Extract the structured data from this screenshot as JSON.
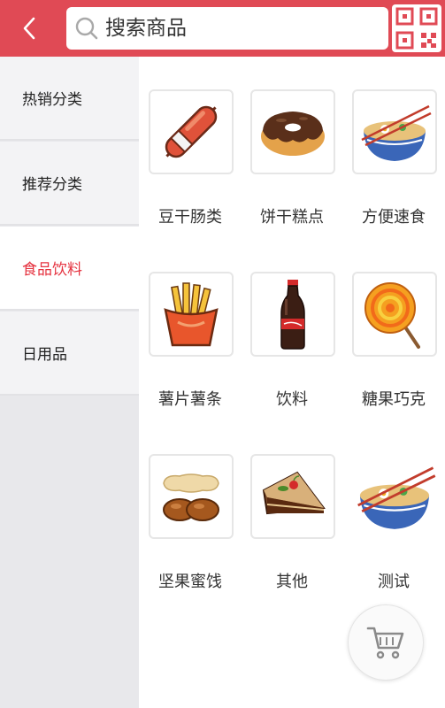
{
  "header": {
    "back_icon": "chevron-left-icon",
    "search_placeholder": "搜索商品",
    "search_icon": "search-icon",
    "qr_icon": "qr-code-icon"
  },
  "sidebar": {
    "items": [
      {
        "label": "热销分类",
        "active": false
      },
      {
        "label": "推荐分类",
        "active": false
      },
      {
        "label": "食品饮料",
        "active": true
      },
      {
        "label": "日用品",
        "active": false
      }
    ]
  },
  "categories": [
    {
      "label": "豆干肠类",
      "icon": "sausage-icon"
    },
    {
      "label": "饼干糕点",
      "icon": "donut-icon"
    },
    {
      "label": "方便速食",
      "icon": "noodle-bowl-icon"
    },
    {
      "label": "薯片薯条",
      "icon": "fries-icon"
    },
    {
      "label": "饮料",
      "icon": "cola-bottle-icon"
    },
    {
      "label": "糖果巧克",
      "icon": "lollipop-icon"
    },
    {
      "label": "坚果蜜饯",
      "icon": "peanut-icon"
    },
    {
      "label": "其他",
      "icon": "cake-icon"
    },
    {
      "label": "测试",
      "icon": "noodle-bowl-icon"
    }
  ],
  "cart": {
    "icon": "shopping-cart-icon"
  },
  "colors": {
    "accent": "#e04a55",
    "active_text": "#e5323f",
    "sidebar_bg": "#e8e8eb"
  }
}
